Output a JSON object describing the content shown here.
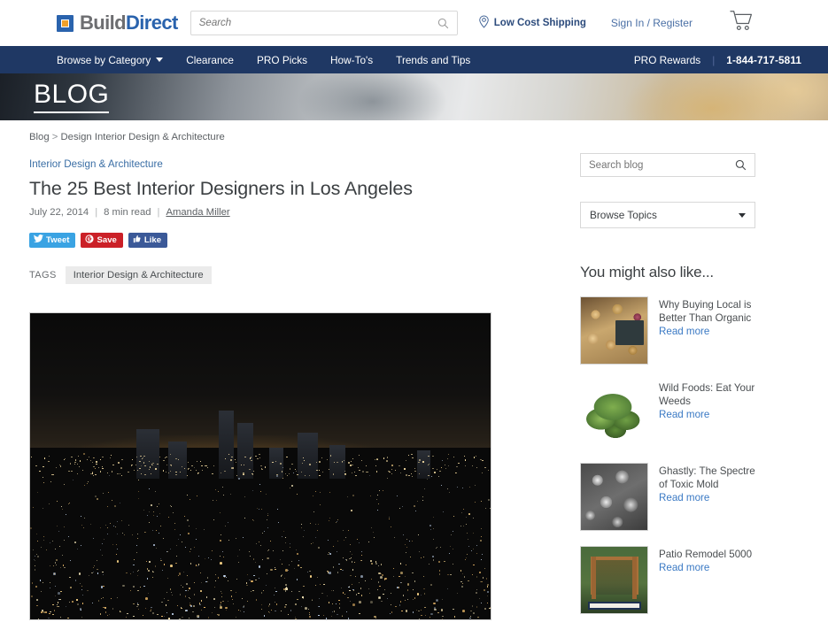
{
  "header": {
    "logo": {
      "part1": "Build",
      "part2": "Direct",
      "icon": "buildirect-square-logo"
    },
    "search": {
      "placeholder": "Search",
      "value": "",
      "icon": "search-icon"
    },
    "shipping_link": "Low Cost Shipping",
    "shipping_icon": "map-pin-icon",
    "account_link": "Sign In / Register",
    "cart_icon": "shopping-cart-icon"
  },
  "nav": {
    "items": [
      {
        "label": "Browse by Category",
        "has_caret": true
      },
      {
        "label": "Clearance",
        "has_caret": false
      },
      {
        "label": "PRO Picks",
        "has_caret": false
      },
      {
        "label": "How-To's",
        "has_caret": false
      },
      {
        "label": "Trends and Tips",
        "has_caret": false
      }
    ],
    "pro_rewards": "PRO Rewards",
    "phone": "1-844-717-5811",
    "bg_color": "#1f3864"
  },
  "hero": {
    "title": "BLOG"
  },
  "breadcrumb": {
    "root": "Blog",
    "sep": ">",
    "current": "Design Interior Design & Architecture"
  },
  "article": {
    "category": "Interior Design & Architecture",
    "title": "The 25 Best Interior Designers in Los Angeles",
    "date": "July 22, 2014",
    "read_time": "8 min read",
    "author": "Amanda Miller",
    "divider": "|",
    "social": [
      {
        "label": "Tweet",
        "icon": "twitter-bird-icon",
        "color": "#3aa3e3"
      },
      {
        "label": "Save",
        "icon": "pinterest-icon",
        "color": "#cb2027"
      },
      {
        "label": "Like",
        "icon": "facebook-thumbs-up-icon",
        "color": "#3b5998"
      }
    ],
    "tags_label": "TAGS",
    "tags": [
      "Interior Design & Architecture"
    ],
    "photo_alt": "Los Angeles downtown skyline at night"
  },
  "sidebar": {
    "search": {
      "placeholder": "Search blog",
      "value": "",
      "icon": "search-icon"
    },
    "topics_select": {
      "value": "Browse Topics",
      "icon": "chevron-down-icon"
    },
    "related_heading": "You might also like...",
    "read_more_label": "Read more",
    "related": [
      {
        "title": "Why Buying Local is Better Than Organic",
        "thumb": "produce-market-thumbnail"
      },
      {
        "title": "Wild Foods: Eat Your Weeds",
        "thumb": "wild-greens-thumbnail"
      },
      {
        "title": "Ghastly: The Spectre of Toxic Mold",
        "thumb": "toxic-mold-thumbnail"
      },
      {
        "title": "Patio Remodel 5000",
        "thumb": "patio-pergola-thumbnail"
      }
    ]
  }
}
